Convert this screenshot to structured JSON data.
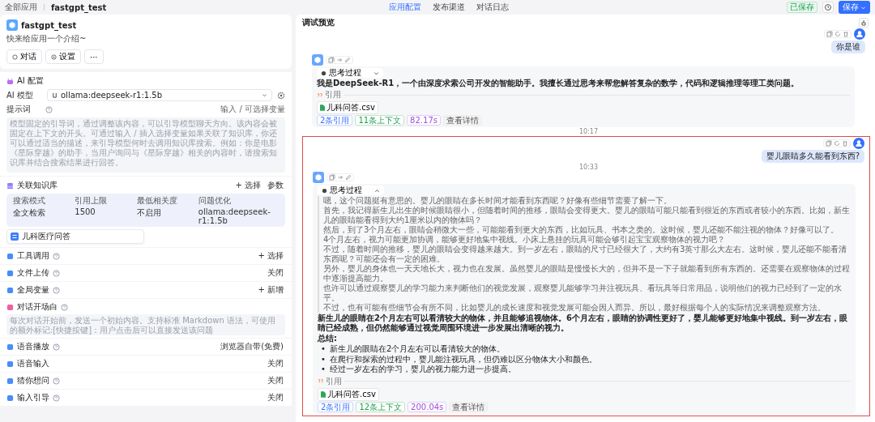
{
  "breadcrumb": [
    "全部应用",
    "fastgpt_test"
  ],
  "tabs": [
    {
      "label": "应用配置",
      "selected": true
    },
    {
      "label": "发布渠道",
      "selected": false
    },
    {
      "label": "对话日志",
      "selected": false
    }
  ],
  "save_status": "已保存",
  "save_button": "保存",
  "app": {
    "name": "fastgpt_test",
    "intro": "快来给应用一个介绍~",
    "buttons": [
      "对话",
      "设置",
      "···"
    ]
  },
  "ai_config": {
    "title": "AI 配置",
    "model_label": "AI 模型",
    "model": "ollama:deepseek-r1:1.5b",
    "prompt_label": "提示词",
    "prompt_hint": "输入 / 可选择变量",
    "prompt_placeholder": "模型固定的引导词，通过调整该内容，可以引导模型聊天方向。该内容会被固定在上下文的开头。可通过输入 / 插入选择变量如果关联了知识库，你还可以通过适当的描述，来引导模型何时去调用知识库搜索。例如：你是电影《星际穿越》的助手，当用户询问与《星际穿越》相关的内容时，请搜索知识库并结合搜索结果进行回答。"
  },
  "knowledge": {
    "title": "关联知识库",
    "actions": [
      "+ 选择",
      "参数"
    ],
    "columns": [
      "搜索模式",
      "引用上限",
      "最低相关度",
      "问题优化"
    ],
    "values": [
      "全文检索",
      "1500",
      "不启用",
      "ollama:deepseek-r1:1.5b"
    ],
    "datasets": [
      "儿科医疗问答"
    ]
  },
  "settings": [
    {
      "kind": "action",
      "label": "工具调用",
      "help": true,
      "value": "+ 选择"
    },
    {
      "kind": "value",
      "label": "文件上传",
      "help": true,
      "value": "关闭"
    },
    {
      "kind": "action",
      "label": "全局变量",
      "help": true,
      "value": "+ 新增"
    },
    {
      "kind": "textarea",
      "label": "对话开场白",
      "help": true,
      "placeholder": "每次对话开始前，发送一个初始内容。支持标准 Markdown 语法，可使用的额外标记:[快捷按键]：用户点击后可以直接发送该问题"
    },
    {
      "kind": "value",
      "label": "语音播放",
      "help": true,
      "value": "浏览器自带(免费)"
    },
    {
      "kind": "value",
      "label": "语音输入",
      "help": false,
      "value": "关闭"
    },
    {
      "kind": "value",
      "label": "猜你想问",
      "help": true,
      "value": "关闭"
    },
    {
      "kind": "value",
      "label": "输入引导",
      "help": true,
      "value": "关闭"
    }
  ],
  "preview": {
    "title": "调试预览",
    "messages": [
      {
        "kind": "user",
        "text": "你是谁",
        "highlighted": false
      },
      {
        "kind": "bot",
        "thinking_label": "思考过程",
        "expanded": false,
        "answer": [
          "我是DeepSeek-R1，一个由深度求索公司开发的智能助手。我擅长通过思考来帮您解答复杂的数学，代码和逻辑推理等理工类问题。"
        ],
        "cite_label": "引用",
        "file": "儿科问答.csv",
        "tags": [
          "2条引用",
          "11条上下文",
          "82.17s",
          "查看详情"
        ],
        "highlighted": false
      },
      {
        "kind": "time",
        "text": "10:17",
        "highlighted": false
      },
      {
        "kind": "user",
        "text": "婴儿眼睛多久能看到东西?",
        "highlighted": true
      },
      {
        "kind": "time",
        "text": "10:33",
        "highlighted": true
      },
      {
        "kind": "bot",
        "thinking_label": "思考过程",
        "expanded": true,
        "thinking": [
          "嗯，这个问题挺有意思的。婴儿的眼睛在多长时间才能看到东西呢？好像有些细节需要了解一下。",
          "首先，我记得新生儿出生的时候眼睛很小，但随着时间的推移，眼睛会变得更大。婴儿的眼睛可能只能看到很近的东西或者较小的东西。比如，新生儿的眼睛能看得到大约1厘米以内的物体吗？",
          "然后，到了3个月左右，眼睛会稍微大一些，可能能看到更大的东西，比如玩具、书本之类的。这时候，婴儿还能不能注视的物体？好像可以了。",
          "4个月左右，视力可能更加协调，能够更好地集中视线。小床上悬挂的玩具可能会够引起宝宝观察物体的视力吧？",
          "不过，随着时间的推移，婴儿的眼睛会变得越来越大。到一岁左右，眼睛的尺寸已经很大了，大约有3英寸那么大左右。这时候，婴儿还能不能看清东西呢？可能还会有一定的困难。",
          "另外，婴儿的身体也一天天地长大，视力也在发展。虽然婴儿的眼睛是慢慢长大的，但并不是一下子就能看到所有东西的。还需要在观察物体的过程中逐渐提高能力。",
          "也许可以通过观察婴儿的学习能力来判断他们的视觉发展，观察婴儿能够学习并注视玩具、看玩具等日常用品，说明他们的视力已经到了一定的水平。",
          "不过，也有可能有些细节会有所不同，比如婴儿的成长速度和视觉发展可能会因人而异。所以，最好根据每个人的实际情况来调整观察方法。"
        ],
        "answer": [
          "新生儿的眼睛在2个月左右可以看清较大的物体，并且能够追视物体。6个月左右，眼睛的协调性更好了，婴儿能够更好地集中视线。到一岁左右，眼睛已经成熟，但仍然能够通过视觉周围环境进一步发展出清晰的视力。"
        ],
        "summary_title": "总结:",
        "bullet_marker": "•",
        "bullets": [
          "新生儿的眼睛在2个月左右可以看清较大的物体。",
          "在爬行和探索的过程中，婴儿能注视玩具，但仍难以区分物体大小和颜色。",
          "经过一岁左右的学习，婴儿的视力能力进一步提高。"
        ],
        "cite_label": "引用",
        "file": "儿科问答.csv",
        "tags": [
          "2条引用",
          "12条上下文",
          "200.04s",
          "查看详情"
        ],
        "highlighted": true
      }
    ]
  }
}
